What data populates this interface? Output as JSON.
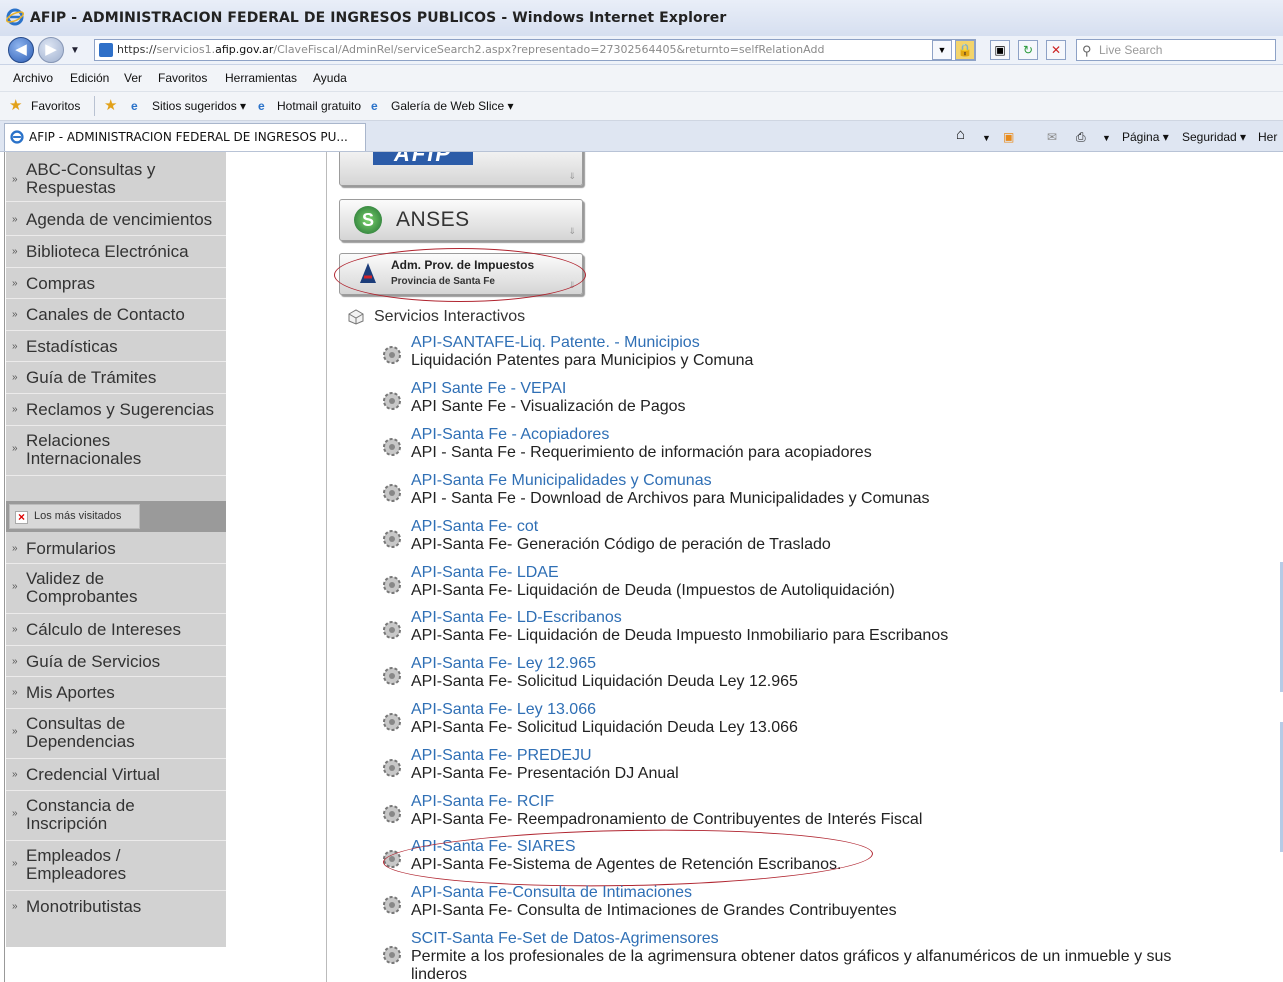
{
  "window": {
    "title": "AFIP - ADMINISTRACION FEDERAL DE INGRESOS PUBLICOS - Windows Internet Explorer",
    "icon": "ie-icon"
  },
  "address_bar": {
    "url_scheme": "https://",
    "url_host_pre": "servicios1.",
    "url_host_dom": "afip.gov.ar",
    "url_path": "/ClaveFiscal/AdminRel/serviceSearch2.aspx?representado=27302564405&returnto=selfRelationAdd",
    "search_placeholder": "Live Search"
  },
  "menu": [
    "Archivo",
    "Edición",
    "Ver",
    "Favoritos",
    "Herramientas",
    "Ayuda"
  ],
  "favorites_bar": {
    "favorites_label": "Favoritos",
    "items": [
      "Sitios sugeridos ▾",
      "Hotmail gratuito",
      "Galería de Web Slice ▾"
    ]
  },
  "tab": {
    "label": "AFIP - ADMINISTRACION FEDERAL DE INGRESOS PU..."
  },
  "command_bar": {
    "pagina": "Página ▾",
    "seguridad": "Seguridad ▾",
    "herramientas": "Her"
  },
  "sidebar": {
    "items": [
      {
        "label": "ABC-Consultas y Respuestas"
      },
      {
        "label": "Agenda de vencimientos"
      },
      {
        "label": "Biblioteca Electrónica"
      },
      {
        "label": "Compras"
      },
      {
        "label": "Canales de Contacto"
      },
      {
        "label": "Estadísticas"
      },
      {
        "label": "Guía de Trámites"
      },
      {
        "label": "Reclamos y Sugerencias"
      },
      {
        "label": "Relaciones Internacionales"
      }
    ],
    "mas_visitados": "Los más visitados",
    "items2": [
      {
        "label": "Formularios"
      },
      {
        "label": "Validez de Comprobantes"
      },
      {
        "label": "Cálculo de Intereses"
      },
      {
        "label": "Guía de Servicios"
      },
      {
        "label": "Mis Aportes"
      },
      {
        "label": "Consultas de Dependencias"
      },
      {
        "label": "Credencial Virtual"
      },
      {
        "label": "Constancia de Inscripción"
      },
      {
        "label": "Empleados / Empleadores"
      },
      {
        "label": "Monotributistas"
      }
    ]
  },
  "orgs": {
    "afip": "AFIP",
    "anses": "ANSES",
    "api_line1": "Adm. Prov. de Impuestos",
    "api_line2": "Provincia de Santa Fe"
  },
  "services": {
    "heading": "Servicios Interactivos",
    "items": [
      {
        "link": "API-SANTAFE-Liq. Patente. - Municipios",
        "desc": "Liquidación Patentes para Municipios y Comuna"
      },
      {
        "link": "API Sante Fe - VEPAI",
        "desc": "API Sante Fe - Visualización de Pagos"
      },
      {
        "link": "API-Santa Fe - Acopiadores",
        "desc": "API - Santa Fe - Requerimiento de información para acopiadores"
      },
      {
        "link": "API-Santa Fe Municipalidades y Comunas",
        "desc": "API - Santa Fe - Download de Archivos para Municipalidades y Comunas"
      },
      {
        "link": "API-Santa Fe- cot",
        "desc": "API-Santa Fe- Generación Código de peración de Traslado"
      },
      {
        "link": "API-Santa Fe- LDAE",
        "desc": "API-Santa Fe- Liquidación de Deuda (Impuestos de Autoliquidación)"
      },
      {
        "link": "API-Santa Fe- LD-Escribanos",
        "desc": "API-Santa Fe- Liquidación de Deuda Impuesto Inmobiliario para Escribanos"
      },
      {
        "link": "API-Santa Fe- Ley 12.965",
        "desc": "API-Santa Fe- Solicitud Liquidación Deuda Ley 12.965"
      },
      {
        "link": "API-Santa Fe- Ley 13.066",
        "desc": "API-Santa Fe- Solicitud Liquidación Deuda Ley 13.066"
      },
      {
        "link": "API-Santa Fe- PREDEJU",
        "desc": "API-Santa Fe- Presentación DJ Anual"
      },
      {
        "link": "API-Santa Fe- RCIF",
        "desc": "API-Santa Fe- Reempadronamiento de Contribuyentes de Interés Fiscal"
      },
      {
        "link": "API-Santa Fe- SIARES",
        "desc": "API-Santa Fe-Sistema de Agentes de Retención Escribanos."
      },
      {
        "link": "API-Santa Fe-Consulta de Intimaciones",
        "desc": "API-Santa Fe- Consulta de Intimaciones de Grandes Contribuyentes"
      },
      {
        "link": "SCIT-Santa Fe-Set de Datos-Agrimensores",
        "desc": "Permite a los profesionales de la agrimensura obtener datos gráficos y alfanuméricos de un inmueble y sus",
        "desc2": "linderos"
      }
    ]
  },
  "colors": {
    "link": "#2f6fb5",
    "sidebar": "#d2d2d2",
    "highlight_ellipse": "#b02530"
  }
}
